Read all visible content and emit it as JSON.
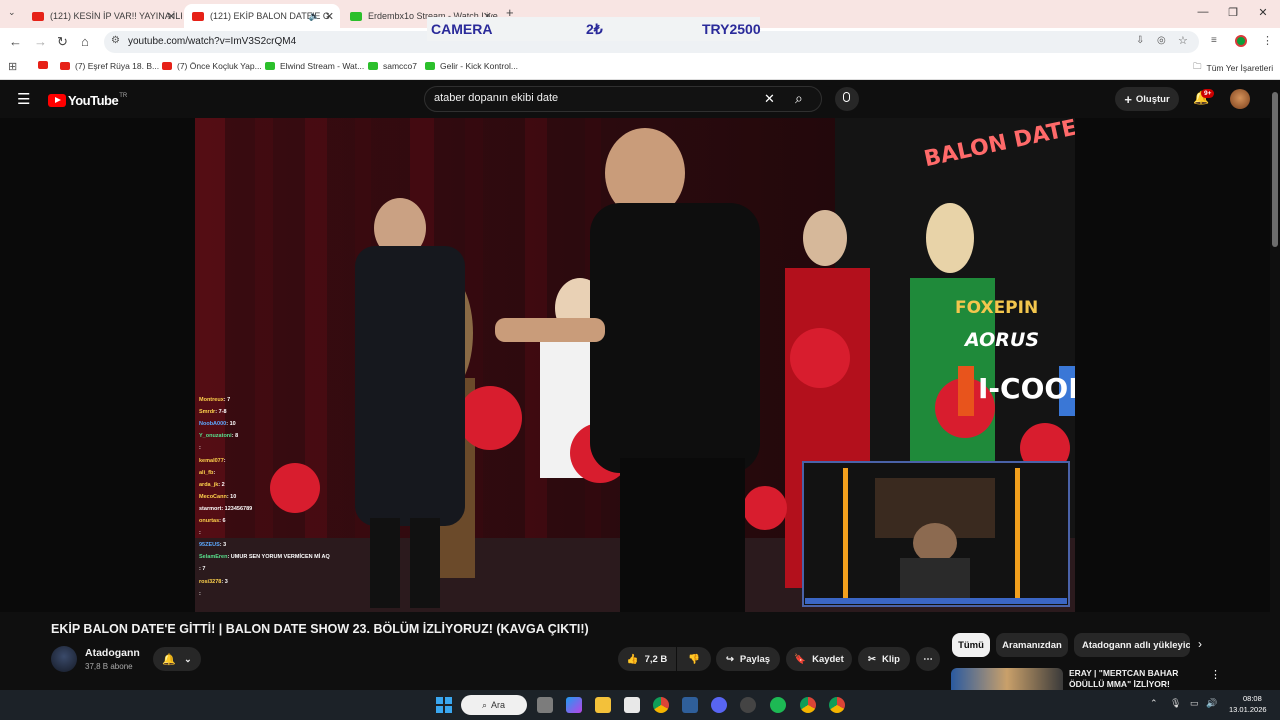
{
  "browser": {
    "tabs": [
      {
        "title": "(121) KESİN İP VAR!! YAYINA İLK",
        "active": false
      },
      {
        "title": "(121) EKİP BALON DATE'E G",
        "active": true
      },
      {
        "title": "Erdembx1o Stream - Watch Live",
        "active": false
      }
    ],
    "url": "youtube.com/watch?v=ImV3S2crQM4",
    "overlay": {
      "camera": "CAMERA",
      "amount": "2₺",
      "goal": "TRY2500"
    },
    "bookmarks": [
      {
        "label": "",
        "type": "yt"
      },
      {
        "label": "(7) Eşref Rüya 18. B...",
        "type": "yt"
      },
      {
        "label": "(7) Önce Koçluk Yap...",
        "type": "yt"
      },
      {
        "label": "Elwind Stream - Wat...",
        "type": "k"
      },
      {
        "label": "samcco7",
        "type": "k"
      },
      {
        "label": "Gelir - Kick Kontrol...",
        "type": "k"
      }
    ],
    "all_bookmarks": "Tüm Yer İşaretleri"
  },
  "youtube": {
    "logo": "YouTube",
    "logo_country": "TR",
    "search_query": "ataber dopanın ekibi date",
    "create_label": "Oluştur",
    "notif_badge": "9+",
    "video_title": "EKİP BALON DATE'E GİTTİ! | BALON DATE SHOW 23. BÖLÜM İZLİYORUZ! (KAVGA ÇIKTI!)",
    "channel_name": "Atadogann",
    "subscribers": "37,8 B abone",
    "likes": "7,2 B",
    "share_label": "Paylaş",
    "save_label": "Kaydet",
    "clip_label": "Klip",
    "filters": [
      "Tümü",
      "Aramanızdan",
      "Atadogann adlı yükleyic"
    ],
    "next_video_title": "ERAY | \"MERTCAN BAHAR ÖDÜLLÜ MMA\" İZLİYOR!"
  },
  "video_overlay": {
    "neon_sign": "BALON DATE SHOW",
    "sponsor1": "FOXEPIN",
    "sponsor2": "AORUS",
    "sponsor3": "I-COOL",
    "chat": [
      {
        "user": "Montreux",
        "msg": ": 7",
        "color": "#ffd34d"
      },
      {
        "user": "Smrdr",
        "msg": ": 7-8",
        "color": "#ffd34d"
      },
      {
        "user": "NoobA000",
        "msg": ": 10",
        "color": "#5da9ff"
      },
      {
        "user": "Y_onuzatoni",
        "msg": ": 8",
        "color": "#58e08c"
      },
      {
        "user": "",
        "msg": ":",
        "color": "#ff6b6b"
      },
      {
        "user": "kemal077",
        "msg": ":",
        "color": "#ffd34d"
      },
      {
        "user": "ali_fb",
        "msg": ":",
        "color": "#ffd34d"
      },
      {
        "user": "arda_jk",
        "msg": ": 2",
        "color": "#ffd34d"
      },
      {
        "user": "MecoCann",
        "msg": ": 10",
        "color": "#ffd34d"
      },
      {
        "user": "starmort",
        "msg": ": 123456789",
        "color": "#ffffff"
      },
      {
        "user": "onurtas",
        "msg": ": 6",
        "color": "#ffd34d"
      },
      {
        "user": "",
        "msg": ":",
        "color": "#5da9ff"
      },
      {
        "user": "95ZEUS",
        "msg": ": 3",
        "color": "#5da9ff"
      },
      {
        "user": "SelamEren",
        "msg": ": UMUR SEN YORUM VERMİCEN Mİ AQ",
        "color": "#58e08c"
      },
      {
        "user": "",
        "msg": ": 7",
        "color": "#ff6b6b"
      },
      {
        "user": "rosi3278",
        "msg": ": 3",
        "color": "#ffd34d"
      },
      {
        "user": "",
        "msg": ":",
        "color": "#ff6b6b"
      }
    ]
  },
  "taskbar": {
    "search_label": "Ara",
    "time": "08:08",
    "date": "13.01.2026"
  }
}
